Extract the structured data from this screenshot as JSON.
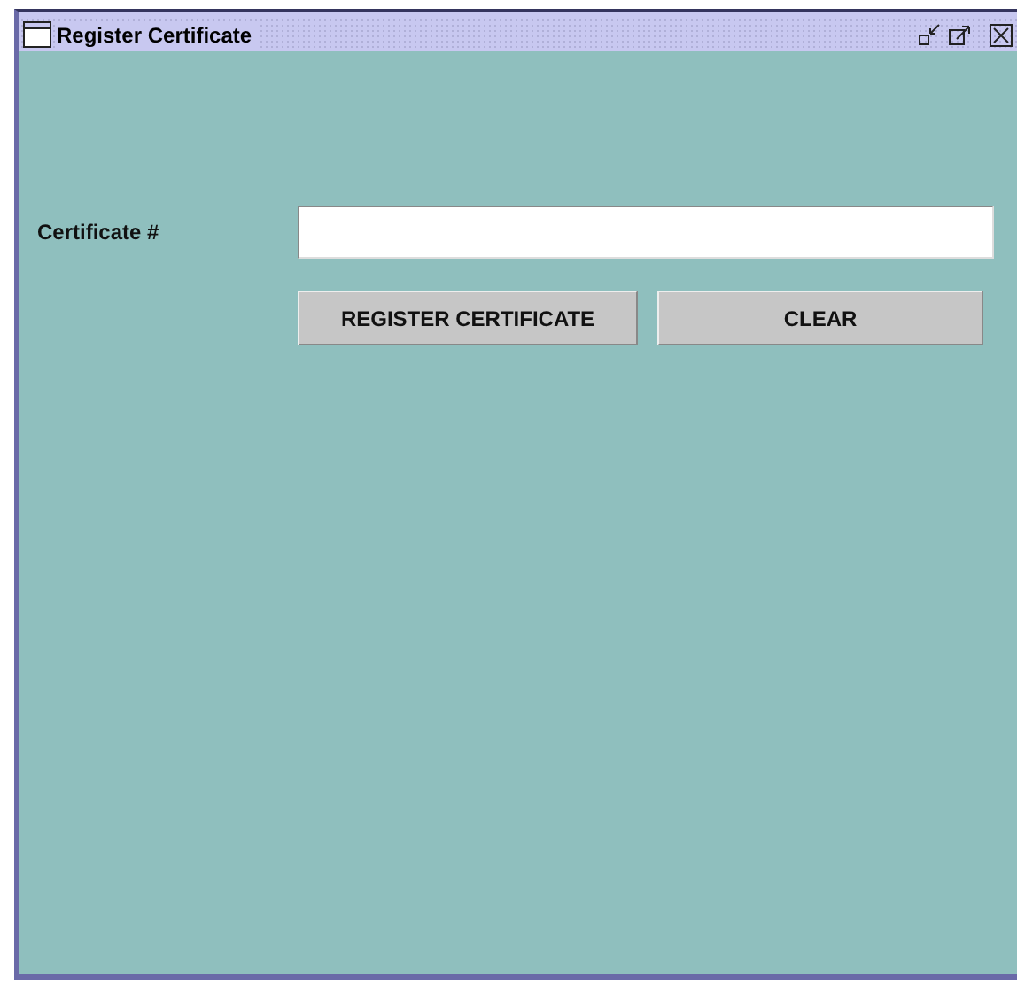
{
  "window": {
    "title": "Register Certificate"
  },
  "form": {
    "label": "Certificate #"
  },
  "buttons": [
    {
      "label": "REGISTER CERTIFICATE"
    },
    {
      "label": "CLEAR"
    }
  ]
}
